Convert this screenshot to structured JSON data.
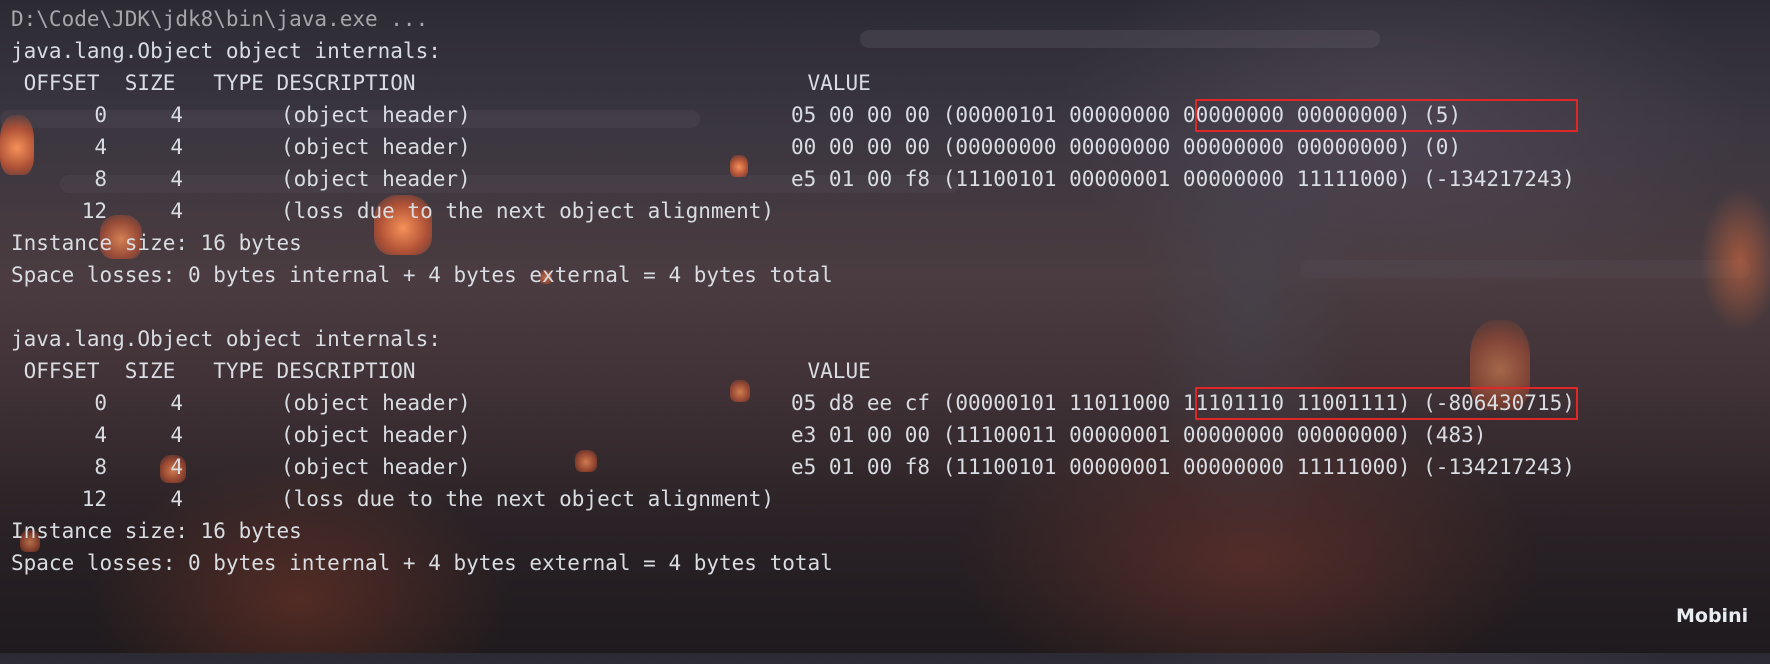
{
  "command_line": "D:\\Code\\JDK\\jdk8\\bin\\java.exe ...",
  "blocks": [
    {
      "title": "java.lang.Object object internals:",
      "header": " OFFSET  SIZE   TYPE DESCRIPTION                               VALUE",
      "rows": [
        {
          "offset": "0",
          "size": "4",
          "description": "(object header)",
          "value": "05 00 00 00 (00000101 00000000 00000000 00000000) (5)"
        },
        {
          "offset": "4",
          "size": "4",
          "description": "(object header)",
          "value": "00 00 00 00 (00000000 00000000 00000000 00000000) (0)"
        },
        {
          "offset": "8",
          "size": "4",
          "description": "(object header)",
          "value": "e5 01 00 f8 (11100101 00000001 00000000 11111000) (-134217243)"
        },
        {
          "offset": "12",
          "size": "4",
          "description": "(loss due to the next object alignment)",
          "value": ""
        }
      ],
      "instance_size": "Instance size: 16 bytes",
      "space_losses": "Space losses: 0 bytes internal + 4 bytes external = 4 bytes total"
    },
    {
      "title": "java.lang.Object object internals:",
      "header": " OFFSET  SIZE   TYPE DESCRIPTION                               VALUE",
      "rows": [
        {
          "offset": "0",
          "size": "4",
          "description": "(object header)",
          "value": "05 d8 ee cf (00000101 11011000 11101110 11001111) (-806430715)"
        },
        {
          "offset": "4",
          "size": "4",
          "description": "(object header)",
          "value": "e3 01 00 00 (11100011 00000001 00000000 00000000) (483)"
        },
        {
          "offset": "8",
          "size": "4",
          "description": "(object header)",
          "value": "e5 01 00 f8 (11100101 00000001 00000000 11111000) (-134217243)"
        },
        {
          "offset": "12",
          "size": "4",
          "description": "(loss due to the next object alignment)",
          "value": ""
        }
      ],
      "instance_size": "Instance size: 16 bytes",
      "space_losses": "Space losses: 0 bytes internal + 4 bytes external = 4 bytes total"
    }
  ],
  "watermark": "Mobini",
  "colors": {
    "text": "#d9dde2",
    "path_text": "#a7a7aa",
    "highlight_box": "#e02727",
    "watermark": "#e8edf2"
  }
}
